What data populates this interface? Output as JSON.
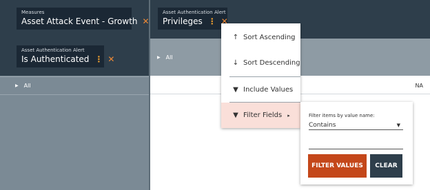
{
  "header_chips": {
    "measures": {
      "caption": "Measures",
      "label": "Asset Attack Event - Growth",
      "remove_icon": "✕"
    },
    "column_field": {
      "caption": "Asset Authentication Alert",
      "label": "Privileges",
      "menu_icon": "⋮",
      "remove_icon": "✕"
    },
    "row_field": {
      "caption": "Asset Authentication Alert",
      "label": "Is Authenticated",
      "menu_icon": "⋮",
      "remove_icon": "✕"
    }
  },
  "grid": {
    "column_header_all": "All",
    "row_header_all": "All",
    "cell_value": "NA"
  },
  "context_menu": {
    "items": [
      {
        "icon": "↑",
        "label": "Sort Ascending"
      },
      {
        "icon": "↓",
        "label": "Sort Descending"
      },
      {
        "icon": "▼",
        "label": "Include Values"
      },
      {
        "icon": "▼",
        "label": "Filter Fields",
        "submenu_arrow": "▸",
        "active": true
      }
    ]
  },
  "filter_panel": {
    "caption": "Filter items by value name:",
    "condition_value": "Contains",
    "condition_options": [
      "Contains"
    ],
    "text_value": "",
    "filter_button": "FILTER VALUES",
    "clear_button": "CLEAR"
  },
  "colors": {
    "header_bg": "#2e3e4b",
    "chip_bg": "#1b2835",
    "accent_orange": "#f08a35",
    "filter_button": "#c4471a",
    "active_item": "#fadfd9"
  }
}
